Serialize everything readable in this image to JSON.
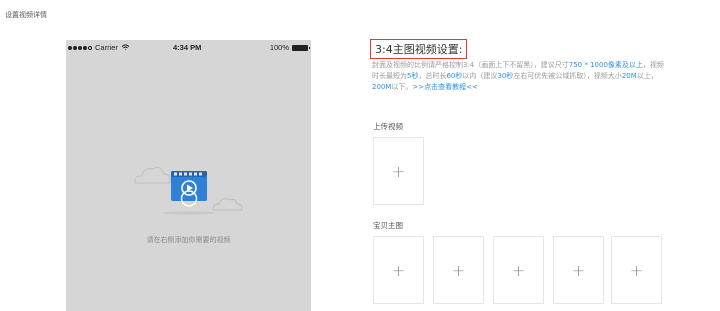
{
  "breadcrumb": "设置视频详情",
  "phone": {
    "signal_text": "Carrier",
    "time": "4:34 PM",
    "battery": "100%",
    "placeholder": "请在右侧添加你需要的视频"
  },
  "settings": {
    "title": "3:4主图视频设置:",
    "desc": [
      {
        "t": "封面及视频的比例请严格控制3:4（画面上下不留黑），建议尺寸",
        "h": false
      },
      {
        "t": "750 * 1000像素及以上",
        "h": true
      },
      {
        "t": "，视频时长最短为",
        "h": false
      },
      {
        "t": "5秒",
        "h": true
      },
      {
        "t": "，总时长",
        "h": false
      },
      {
        "t": "60秒",
        "h": true
      },
      {
        "t": "以内（建议",
        "h": false
      },
      {
        "t": "30秒",
        "h": true
      },
      {
        "t": "左右可优先被公域抓取），视频大小",
        "h": false
      },
      {
        "t": "20M",
        "h": true
      },
      {
        "t": "以上，",
        "h": false
      },
      {
        "t": "200M",
        "h": true
      },
      {
        "t": "以下。",
        "h": false
      },
      {
        "t": ">>点击查看教程<<",
        "h": true
      }
    ],
    "upload_video_label": "上传视频",
    "main_image_label": "宝贝主图",
    "plus": "+"
  },
  "colors": {
    "accent_blue": "#2f8fe6",
    "title_border": "#e53935",
    "phone_bg": "#d6d6d6"
  },
  "icons": [
    "signal-dots-icon",
    "wifi-icon",
    "battery-icon",
    "video-placeholder-icon",
    "cloud-icon",
    "play-icon",
    "plus-icon"
  ]
}
